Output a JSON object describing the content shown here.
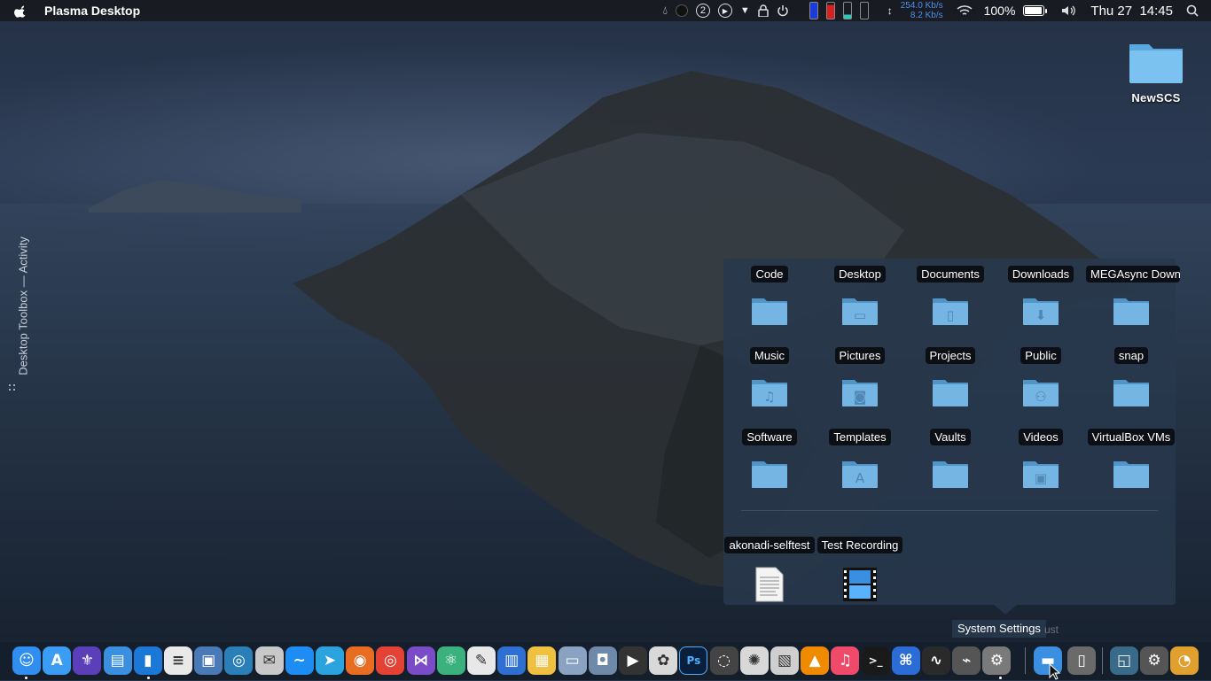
{
  "menubar": {
    "app_title": "Plasma Desktop",
    "tray": {
      "badge_number": "2",
      "net_up": "254.0 Kb/s",
      "net_down": "8.2 Kb/s",
      "battery_percent": "100%",
      "datetime": "Thu 27  14:45"
    }
  },
  "toolbox": {
    "label": "Desktop Toolbox — Activity"
  },
  "desktop_icons": [
    {
      "label": "NewSCS",
      "icon": "folder-icon"
    }
  ],
  "folder_view": {
    "folders": [
      {
        "label": "Code",
        "icon": "folder-icon"
      },
      {
        "label": "Desktop",
        "icon": "folder-desktop-icon"
      },
      {
        "label": "Documents",
        "icon": "folder-documents-icon"
      },
      {
        "label": "Downloads",
        "icon": "folder-downloads-icon"
      },
      {
        "label": "MEGAsync Downloads",
        "icon": "folder-icon"
      },
      {
        "label": "Music",
        "icon": "folder-music-icon"
      },
      {
        "label": "Pictures",
        "icon": "folder-pictures-icon"
      },
      {
        "label": "Projects",
        "icon": "folder-icon"
      },
      {
        "label": "Public",
        "icon": "folder-public-icon"
      },
      {
        "label": "snap",
        "icon": "folder-icon"
      },
      {
        "label": "Software",
        "icon": "folder-icon"
      },
      {
        "label": "Templates",
        "icon": "folder-templates-icon"
      },
      {
        "label": "Vaults",
        "icon": "folder-icon"
      },
      {
        "label": "Videos",
        "icon": "folder-videos-icon"
      },
      {
        "label": "VirtualBox VMs",
        "icon": "folder-icon"
      }
    ],
    "files": [
      {
        "label": "akonadi-selftest",
        "icon": "text-document-icon"
      },
      {
        "label": "Test Recording",
        "icon": "video-file-icon"
      }
    ]
  },
  "tooltip": {
    "text": "System Settings",
    "ghost_text": "ust"
  },
  "dock": {
    "apps": [
      {
        "name": "finder-icon",
        "color": "#2f8ef0",
        "glyph": "☺"
      },
      {
        "name": "app-store-icon",
        "color": "#3a9cf2",
        "glyph": "A"
      },
      {
        "name": "fleur-app-icon",
        "color": "#5a3fb8",
        "glyph": "⚜"
      },
      {
        "name": "files-icon",
        "color": "#3a8fe0",
        "glyph": "▤"
      },
      {
        "name": "phone-connect-icon",
        "color": "#1b78d6",
        "glyph": "▮"
      },
      {
        "name": "news-reader-icon",
        "color": "#e9e9e9",
        "glyph": "≡"
      },
      {
        "name": "image-viewer-icon",
        "color": "#4a79b8",
        "glyph": "▣"
      },
      {
        "name": "browser-globe-icon",
        "color": "#2a7fb8",
        "glyph": "◎"
      },
      {
        "name": "mail-icon",
        "color": "#c8c8c8",
        "glyph": "✉"
      },
      {
        "name": "messenger-icon",
        "color": "#1d8cf3",
        "glyph": "~"
      },
      {
        "name": "telegram-icon",
        "color": "#2aa3df",
        "glyph": "➤"
      },
      {
        "name": "firefox-icon",
        "color": "#e86d23",
        "glyph": "◉"
      },
      {
        "name": "chrome-icon",
        "color": "#e34234",
        "glyph": "◎"
      },
      {
        "name": "visual-studio-icon",
        "color": "#7a4cc7",
        "glyph": "⋈"
      },
      {
        "name": "atom-icon",
        "color": "#3bb27d",
        "glyph": "⚛"
      },
      {
        "name": "text-editor-icon",
        "color": "#e8e8e8",
        "glyph": "✎"
      },
      {
        "name": "charts-app-icon",
        "color": "#2e6fd1",
        "glyph": "▥"
      },
      {
        "name": "office-app-icon",
        "color": "#f0c040",
        "glyph": "▦"
      },
      {
        "name": "screenshot-icon",
        "color": "#8aa3c2",
        "glyph": "▭"
      },
      {
        "name": "camera-icon",
        "color": "#6e8aa8",
        "glyph": "◘"
      },
      {
        "name": "video-editor-icon",
        "color": "#333333",
        "glyph": "▶"
      },
      {
        "name": "photo-app-icon",
        "color": "#d9d9d9",
        "glyph": "✿"
      },
      {
        "name": "photoshop-icon",
        "color": "#0a1f3b",
        "glyph": "Ps"
      },
      {
        "name": "recorder-icon",
        "color": "#444444",
        "glyph": "◌"
      },
      {
        "name": "photos-icon",
        "color": "#d8d8d8",
        "glyph": "✺"
      },
      {
        "name": "archive-icon",
        "color": "#cfcfcf",
        "glyph": "▧"
      },
      {
        "name": "vlc-icon",
        "color": "#f08a00",
        "glyph": "▲"
      },
      {
        "name": "music-icon",
        "color": "#f04a6a",
        "glyph": "♫"
      },
      {
        "name": "terminal-icon",
        "color": "#1a1a1a",
        "glyph": ">_"
      },
      {
        "name": "keyboard-icon",
        "color": "#2b6cd6",
        "glyph": "⌘"
      },
      {
        "name": "system-monitor-icon",
        "color": "#2a2a2a",
        "glyph": "∿"
      },
      {
        "name": "network-tool-icon",
        "color": "#555555",
        "glyph": "⌁"
      },
      {
        "name": "system-settings-icon",
        "color": "#7a7a7a",
        "glyph": "⚙"
      }
    ],
    "right": [
      {
        "name": "downloads-folder-icon",
        "color": "#3a8fe0",
        "glyph": "▬"
      },
      {
        "name": "trash-icon",
        "color": "#6a6a6a",
        "glyph": "▯"
      },
      {
        "name": "desktop-switcher-icon",
        "color": "#3a6a8a",
        "glyph": "◱"
      },
      {
        "name": "preferences-icon",
        "color": "#555555",
        "glyph": "⚙"
      },
      {
        "name": "launcher-icon",
        "color": "#e0a030",
        "glyph": "◔"
      }
    ]
  }
}
